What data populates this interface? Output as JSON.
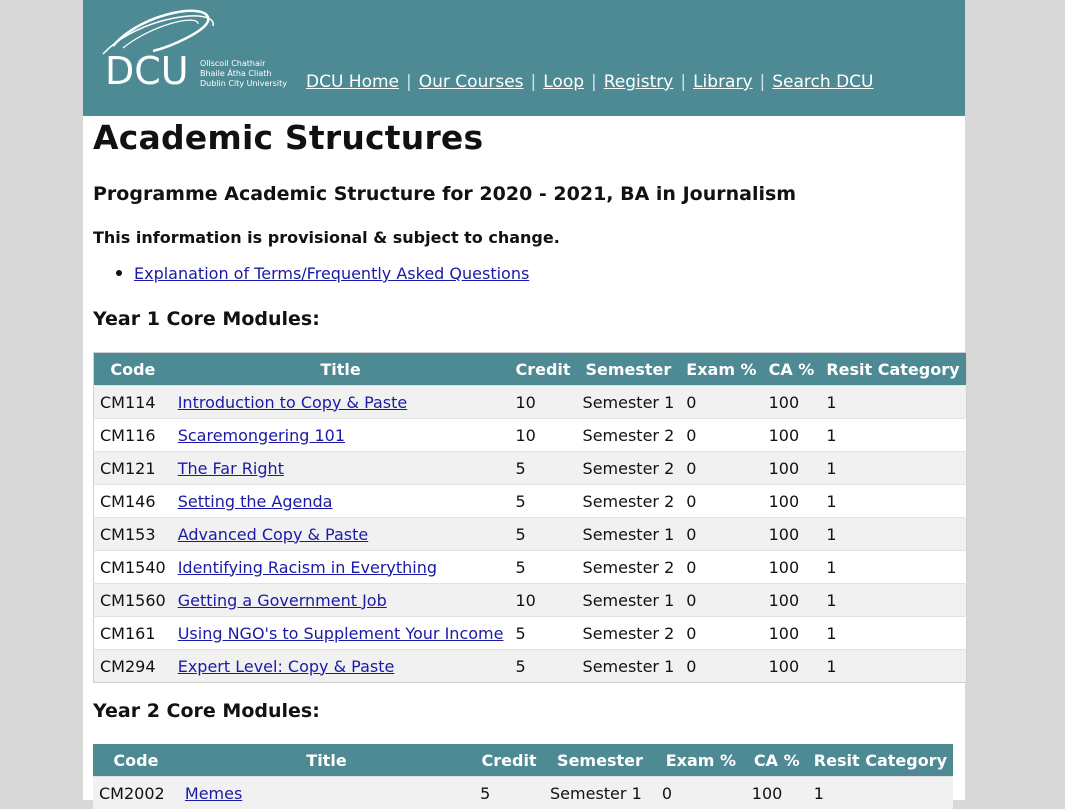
{
  "brand": {
    "logo_text": "DCU",
    "logo_line1": "Ollscoil Chathair",
    "logo_line2": "Bhaile Átha Cliath",
    "logo_line3": "Dublin City University",
    "accent": "#4d8a93"
  },
  "nav": {
    "items": [
      "DCU Home",
      "Our Courses",
      "Loop",
      "Registry",
      "Library",
      "Search DCU"
    ],
    "separator": "|"
  },
  "page": {
    "title": "Academic Structures",
    "subtitle": "Programme Academic Structure for 2020 - 2021, BA in Journalism",
    "notice": "This information is provisional & subject to change.",
    "faq_link": "Explanation of Terms/Frequently Asked Questions"
  },
  "year1": {
    "heading": "Year 1 Core Modules:",
    "columns": [
      "Code",
      "Title",
      "Credit",
      "Semester",
      "Exam %",
      "CA %",
      "Resit Category"
    ],
    "rows": [
      {
        "code": "CM114",
        "title": "Introduction to Copy & Paste",
        "credit": "10",
        "semester": "Semester 1",
        "exam": "0",
        "ca": "100",
        "resit": "1"
      },
      {
        "code": "CM116",
        "title": "Scaremongering 101",
        "credit": "10",
        "semester": "Semester 2",
        "exam": "0",
        "ca": "100",
        "resit": "1"
      },
      {
        "code": "CM121",
        "title": "The Far Right",
        "credit": "5",
        "semester": "Semester 2",
        "exam": "0",
        "ca": "100",
        "resit": "1"
      },
      {
        "code": "CM146",
        "title": "Setting the Agenda",
        "credit": "5",
        "semester": "Semester 2",
        "exam": "0",
        "ca": "100",
        "resit": "1"
      },
      {
        "code": "CM153",
        "title": "Advanced Copy & Paste",
        "credit": "5",
        "semester": "Semester 1",
        "exam": "0",
        "ca": "100",
        "resit": "1"
      },
      {
        "code": "CM1540",
        "title": "Identifying Racism in Everything",
        "credit": "5",
        "semester": "Semester 2",
        "exam": "0",
        "ca": "100",
        "resit": "1"
      },
      {
        "code": "CM1560",
        "title": "Getting a Government Job",
        "credit": "10",
        "semester": "Semester 1",
        "exam": "0",
        "ca": "100",
        "resit": "1"
      },
      {
        "code": "CM161",
        "title": "Using NGO's to Supplement Your Income",
        "credit": "5",
        "semester": "Semester 2",
        "exam": "0",
        "ca": "100",
        "resit": "1"
      },
      {
        "code": "CM294",
        "title": "Expert Level: Copy & Paste",
        "credit": "5",
        "semester": "Semester 1",
        "exam": "0",
        "ca": "100",
        "resit": "1"
      }
    ]
  },
  "year2": {
    "heading": "Year 2 Core Modules:",
    "columns": [
      "Code",
      "Title",
      "Credit",
      "Semester",
      "Exam %",
      "CA %",
      "Resit Category"
    ],
    "rows": [
      {
        "code": "CM2002",
        "title": "Memes",
        "credit": "5",
        "semester": "Semester 1",
        "exam": "0",
        "ca": "100",
        "resit": "1"
      }
    ]
  }
}
